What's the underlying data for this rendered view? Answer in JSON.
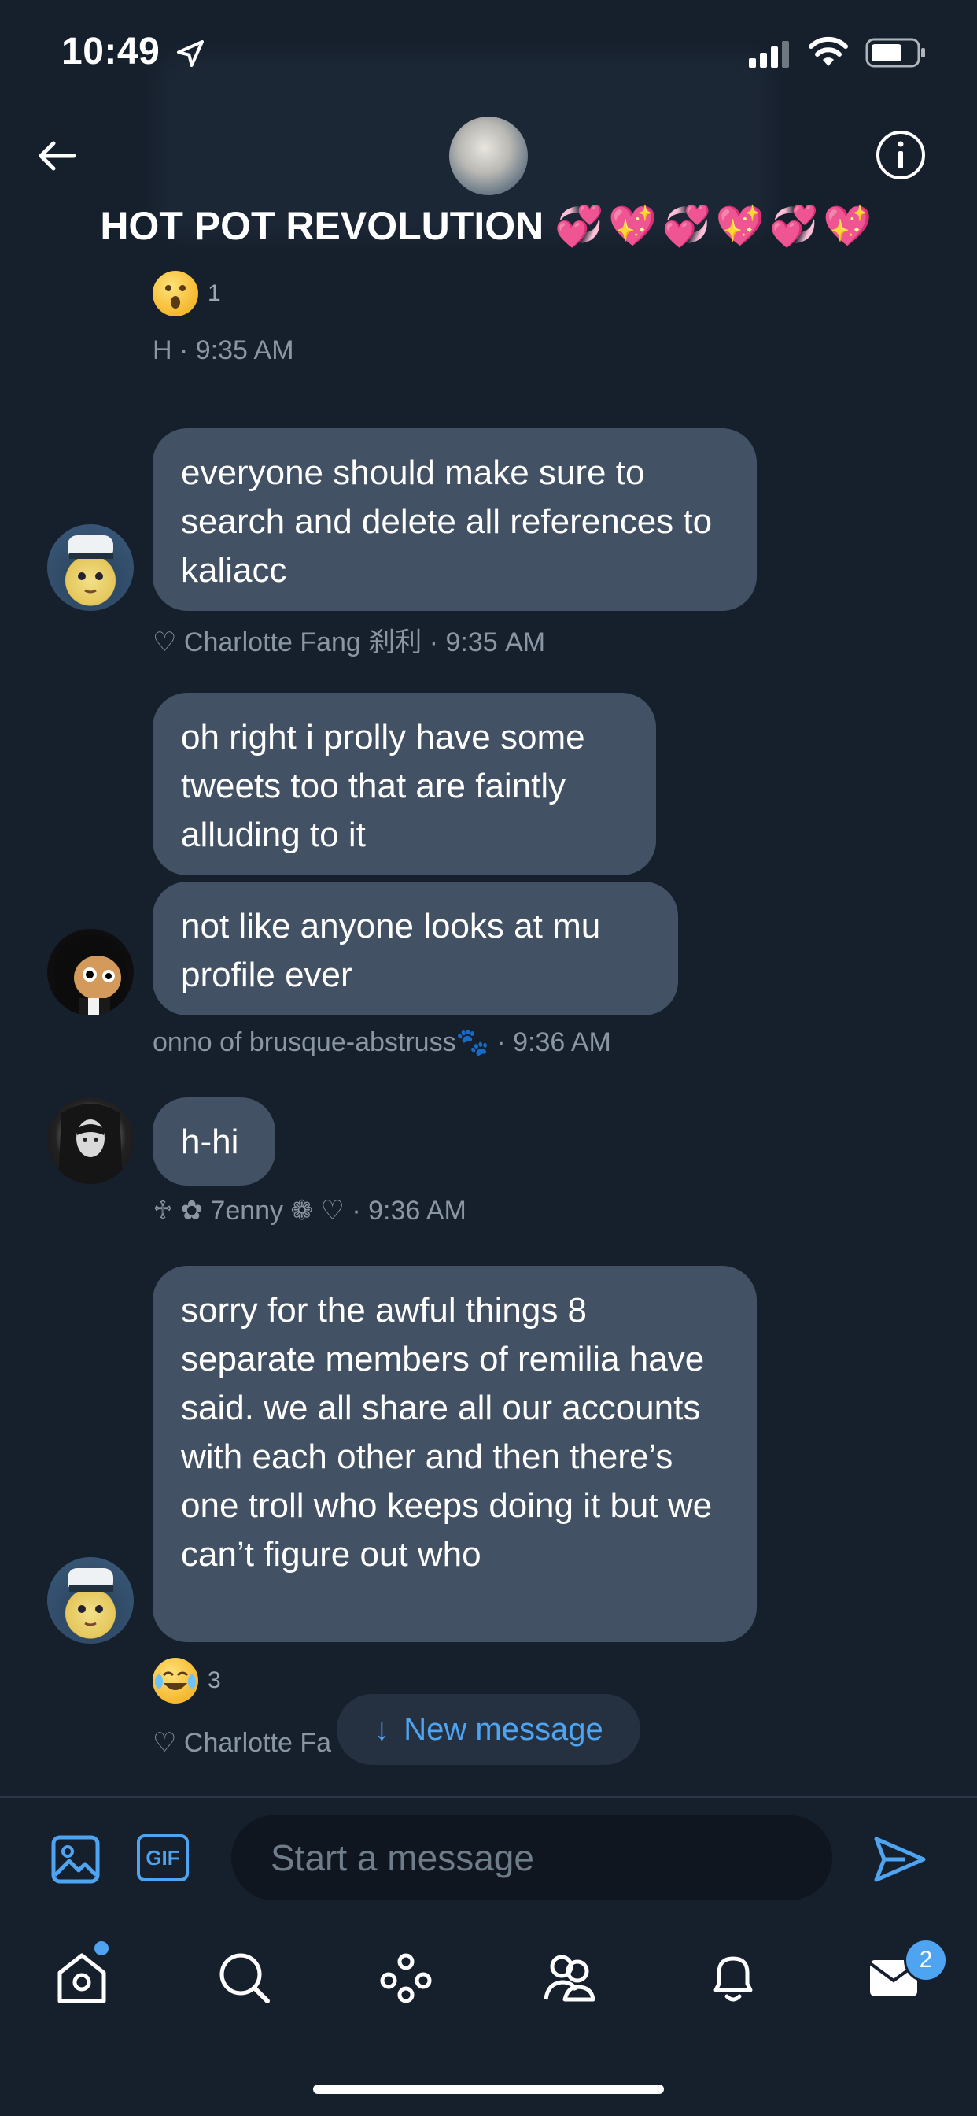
{
  "status_bar": {
    "time": "10:49"
  },
  "header": {
    "title": "HOT POT REVOLUTION",
    "title_emoji": "💞💖💞💖💞💖"
  },
  "messages": {
    "prev_reaction_count": "1",
    "prev_meta": "H · 9:35 AM",
    "m1_text": "everyone should make sure to search and delete all references to kaliacc",
    "m1_meta": "♡ Charlotte Fang 刹利 · 9:35 AM",
    "m2_text": "oh right i prolly have some tweets too that are faintly alluding to it",
    "m3_text": "not like anyone looks at mu profile ever",
    "m3_meta": "onno of brusque-abstruss🐾 · 9:36 AM",
    "m4_text": "h-hi",
    "m4_meta": "♱ ✿ 7enny ❁ ♡ · 9:36 AM",
    "m5_text": "sorry for the awful things 8 separate members of remilia have said. we all share all our accounts with each other and then there’s one troll who keeps doing it but we can’t figure out who",
    "m5_reaction_count": "3",
    "m5_meta": "♡ Charlotte Fa"
  },
  "new_message_pill": {
    "arrow": "↓",
    "label": "New message"
  },
  "composer": {
    "placeholder": "Start a message",
    "gif_label": "GIF"
  },
  "tabbar": {
    "messages_badge": "2"
  },
  "colors": {
    "accent": "#4ea4f0",
    "bubble": "#425164",
    "background": "#16202d"
  }
}
